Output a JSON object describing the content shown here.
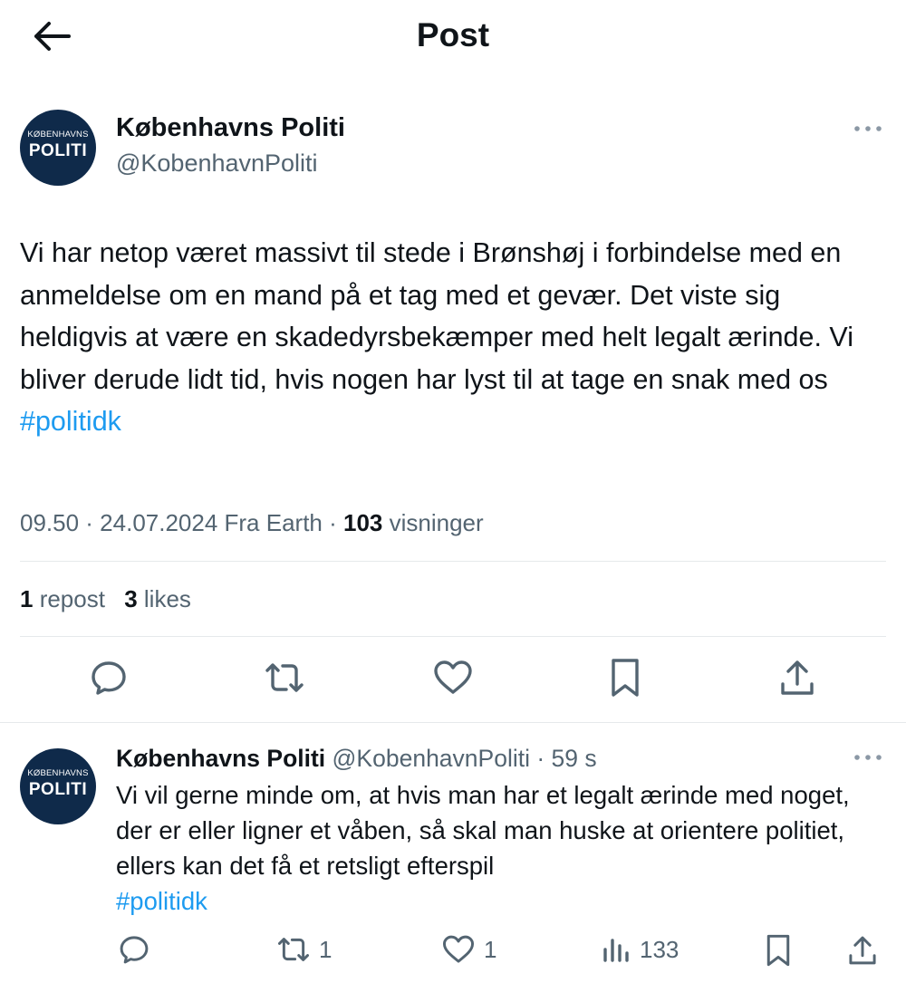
{
  "header": {
    "title": "Post",
    "back_icon": "arrow-left-icon"
  },
  "post": {
    "author": {
      "display_name": "Københavns Politi",
      "handle": "@KobenhavnPoliti",
      "avatar_top": "KØBENHAVNS",
      "avatar_bottom": "POLITI",
      "avatar_color": "#0f2a4a"
    },
    "text": "Vi har netop været massivt til stede i Brønshøj i forbindelse med en anmeldelse om en mand på et tag med et gevær. Det viste sig heldigvis at være en skadedyrsbekæmper med helt legalt ærinde. Vi bliver derude lidt tid, hvis nogen har lyst til at tage en snak med os ",
    "hashtag": "#politidk",
    "meta_time": "09.50 · 24.07.2024 Fra Earth · ",
    "views_count": "103",
    "views_label": " visninger",
    "reposts_count": "1",
    "reposts_label": " repost",
    "likes_count": "3",
    "likes_label": " likes",
    "actions": [
      "reply-icon",
      "repost-icon",
      "like-icon",
      "bookmark-icon",
      "share-icon"
    ]
  },
  "reply": {
    "display_name": "Københavns Politi",
    "handle_time": " @KobenhavnPoliti · 59 s",
    "text": "Vi vil gerne minde om, at hvis man har et legalt ærinde med noget, der er eller ligner et våben, så skal man huske at orientere politiet, ellers kan det få et retsligt efterspil",
    "hashtag": "#politidk",
    "reposts": "1",
    "likes": "1",
    "views": "133"
  },
  "colors": {
    "accent": "#1d9bf0",
    "text": "#0f1419",
    "secondary": "#536471",
    "divider": "#e6e9eb"
  }
}
